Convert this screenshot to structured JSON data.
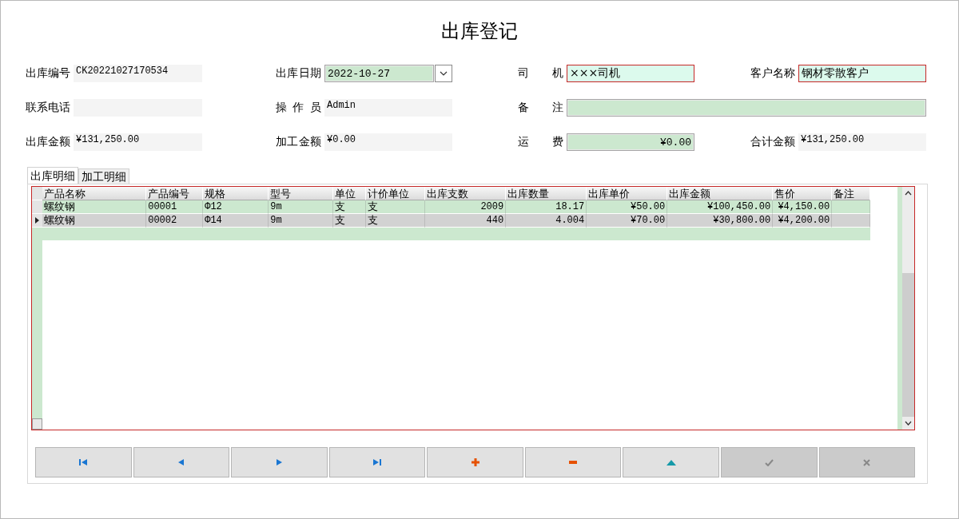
{
  "window": {
    "title": "出库登记"
  },
  "form": {
    "rows": [
      [
        {
          "label": "出库编号",
          "value": "CK20221027170534",
          "kind": "readonly"
        },
        {
          "label": "出库日期",
          "value": "2022-10-27",
          "kind": "date"
        },
        {
          "label": "司 机",
          "value": "×××司机",
          "kind": "required"
        },
        {
          "label": "客户名称",
          "value": "钢材零散客户",
          "kind": "required"
        }
      ],
      [
        {
          "label": "联系电话",
          "kind": "readonly"
        },
        {
          "label": "操 作 员",
          "value": "Admin",
          "kind": "readonly"
        },
        {
          "label": "备 注",
          "kind": "input"
        }
      ],
      [
        {
          "label": "出库金额",
          "value": "¥131,250.00",
          "kind": "readonly"
        },
        {
          "label": "加工金额",
          "value": "¥0.00",
          "kind": "readonly"
        },
        {
          "label": "运 费",
          "value": "¥0.00",
          "kind": "amount"
        },
        {
          "label": "合计金额",
          "value": "¥131,250.00",
          "kind": "readonly"
        }
      ]
    ]
  },
  "tabs": [
    {
      "label": "出库明细",
      "selected": true
    },
    {
      "label": "加工明细",
      "selected": false
    }
  ],
  "table": {
    "columns": [
      "产品名称",
      "产品编号",
      "规格",
      "型号",
      "单位",
      "计价单位",
      "出库支数",
      "出库数量",
      "出库单价",
      "出库金额",
      "售价",
      "备注"
    ],
    "rows": [
      {
        "cells": [
          "螺纹钢",
          "00001",
          "Φ12",
          "9m",
          "支",
          "支",
          "2009",
          "18.17",
          "¥50.00",
          "¥100,450.00",
          "¥4,150.00",
          ""
        ],
        "selected": false
      },
      {
        "cells": [
          "螺纹钢",
          "00002",
          "Φ14",
          "9m",
          "支",
          "支",
          "440",
          "4.004",
          "¥70.00",
          "¥30,800.00",
          "¥4,200.00",
          ""
        ],
        "selected": true
      }
    ]
  },
  "buttons": [
    {
      "kind": "first",
      "disabled": false
    },
    {
      "kind": "prev",
      "disabled": false
    },
    {
      "kind": "next",
      "disabled": false
    },
    {
      "kind": "last",
      "disabled": false
    },
    {
      "kind": "add",
      "disabled": false
    },
    {
      "kind": "remove",
      "disabled": false
    },
    {
      "kind": "up",
      "disabled": false
    },
    {
      "kind": "confirm",
      "disabled": true
    },
    {
      "kind": "cancel",
      "disabled": true
    }
  ]
}
